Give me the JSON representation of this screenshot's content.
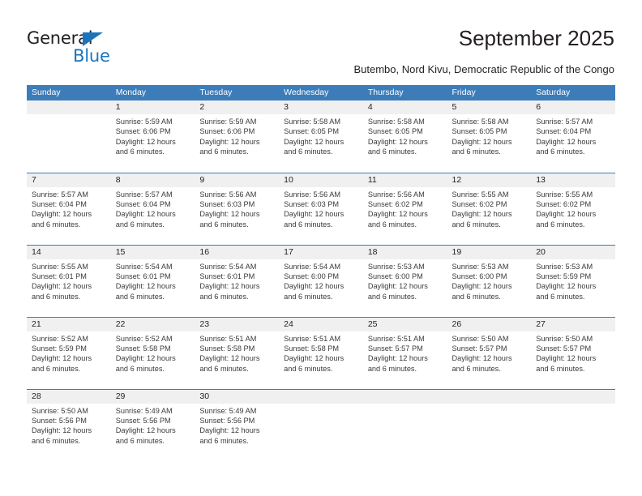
{
  "brand": {
    "line1": "General",
    "line2": "Blue",
    "triangle_icon": "triangle-icon",
    "color_dark": "#231f20",
    "color_blue": "#1c75bc"
  },
  "header": {
    "title": "September 2025",
    "subtitle": "Butembo, Nord Kivu, Democratic Republic of the Congo"
  },
  "calendar": {
    "header_color": "#3c7cb9",
    "daynum_bg": "#f0f0f0",
    "weekdays": [
      "Sunday",
      "Monday",
      "Tuesday",
      "Wednesday",
      "Thursday",
      "Friday",
      "Saturday"
    ],
    "weeks": [
      [
        {
          "day": "",
          "sunrise": "",
          "sunset": "",
          "daylight1": "",
          "daylight2": ""
        },
        {
          "day": "1",
          "sunrise": "Sunrise: 5:59 AM",
          "sunset": "Sunset: 6:06 PM",
          "daylight1": "Daylight: 12 hours",
          "daylight2": "and 6 minutes."
        },
        {
          "day": "2",
          "sunrise": "Sunrise: 5:59 AM",
          "sunset": "Sunset: 6:06 PM",
          "daylight1": "Daylight: 12 hours",
          "daylight2": "and 6 minutes."
        },
        {
          "day": "3",
          "sunrise": "Sunrise: 5:58 AM",
          "sunset": "Sunset: 6:05 PM",
          "daylight1": "Daylight: 12 hours",
          "daylight2": "and 6 minutes."
        },
        {
          "day": "4",
          "sunrise": "Sunrise: 5:58 AM",
          "sunset": "Sunset: 6:05 PM",
          "daylight1": "Daylight: 12 hours",
          "daylight2": "and 6 minutes."
        },
        {
          "day": "5",
          "sunrise": "Sunrise: 5:58 AM",
          "sunset": "Sunset: 6:05 PM",
          "daylight1": "Daylight: 12 hours",
          "daylight2": "and 6 minutes."
        },
        {
          "day": "6",
          "sunrise": "Sunrise: 5:57 AM",
          "sunset": "Sunset: 6:04 PM",
          "daylight1": "Daylight: 12 hours",
          "daylight2": "and 6 minutes."
        }
      ],
      [
        {
          "day": "7",
          "sunrise": "Sunrise: 5:57 AM",
          "sunset": "Sunset: 6:04 PM",
          "daylight1": "Daylight: 12 hours",
          "daylight2": "and 6 minutes."
        },
        {
          "day": "8",
          "sunrise": "Sunrise: 5:57 AM",
          "sunset": "Sunset: 6:04 PM",
          "daylight1": "Daylight: 12 hours",
          "daylight2": "and 6 minutes."
        },
        {
          "day": "9",
          "sunrise": "Sunrise: 5:56 AM",
          "sunset": "Sunset: 6:03 PM",
          "daylight1": "Daylight: 12 hours",
          "daylight2": "and 6 minutes."
        },
        {
          "day": "10",
          "sunrise": "Sunrise: 5:56 AM",
          "sunset": "Sunset: 6:03 PM",
          "daylight1": "Daylight: 12 hours",
          "daylight2": "and 6 minutes."
        },
        {
          "day": "11",
          "sunrise": "Sunrise: 5:56 AM",
          "sunset": "Sunset: 6:02 PM",
          "daylight1": "Daylight: 12 hours",
          "daylight2": "and 6 minutes."
        },
        {
          "day": "12",
          "sunrise": "Sunrise: 5:55 AM",
          "sunset": "Sunset: 6:02 PM",
          "daylight1": "Daylight: 12 hours",
          "daylight2": "and 6 minutes."
        },
        {
          "day": "13",
          "sunrise": "Sunrise: 5:55 AM",
          "sunset": "Sunset: 6:02 PM",
          "daylight1": "Daylight: 12 hours",
          "daylight2": "and 6 minutes."
        }
      ],
      [
        {
          "day": "14",
          "sunrise": "Sunrise: 5:55 AM",
          "sunset": "Sunset: 6:01 PM",
          "daylight1": "Daylight: 12 hours",
          "daylight2": "and 6 minutes."
        },
        {
          "day": "15",
          "sunrise": "Sunrise: 5:54 AM",
          "sunset": "Sunset: 6:01 PM",
          "daylight1": "Daylight: 12 hours",
          "daylight2": "and 6 minutes."
        },
        {
          "day": "16",
          "sunrise": "Sunrise: 5:54 AM",
          "sunset": "Sunset: 6:01 PM",
          "daylight1": "Daylight: 12 hours",
          "daylight2": "and 6 minutes."
        },
        {
          "day": "17",
          "sunrise": "Sunrise: 5:54 AM",
          "sunset": "Sunset: 6:00 PM",
          "daylight1": "Daylight: 12 hours",
          "daylight2": "and 6 minutes."
        },
        {
          "day": "18",
          "sunrise": "Sunrise: 5:53 AM",
          "sunset": "Sunset: 6:00 PM",
          "daylight1": "Daylight: 12 hours",
          "daylight2": "and 6 minutes."
        },
        {
          "day": "19",
          "sunrise": "Sunrise: 5:53 AM",
          "sunset": "Sunset: 6:00 PM",
          "daylight1": "Daylight: 12 hours",
          "daylight2": "and 6 minutes."
        },
        {
          "day": "20",
          "sunrise": "Sunrise: 5:53 AM",
          "sunset": "Sunset: 5:59 PM",
          "daylight1": "Daylight: 12 hours",
          "daylight2": "and 6 minutes."
        }
      ],
      [
        {
          "day": "21",
          "sunrise": "Sunrise: 5:52 AM",
          "sunset": "Sunset: 5:59 PM",
          "daylight1": "Daylight: 12 hours",
          "daylight2": "and 6 minutes."
        },
        {
          "day": "22",
          "sunrise": "Sunrise: 5:52 AM",
          "sunset": "Sunset: 5:58 PM",
          "daylight1": "Daylight: 12 hours",
          "daylight2": "and 6 minutes."
        },
        {
          "day": "23",
          "sunrise": "Sunrise: 5:51 AM",
          "sunset": "Sunset: 5:58 PM",
          "daylight1": "Daylight: 12 hours",
          "daylight2": "and 6 minutes."
        },
        {
          "day": "24",
          "sunrise": "Sunrise: 5:51 AM",
          "sunset": "Sunset: 5:58 PM",
          "daylight1": "Daylight: 12 hours",
          "daylight2": "and 6 minutes."
        },
        {
          "day": "25",
          "sunrise": "Sunrise: 5:51 AM",
          "sunset": "Sunset: 5:57 PM",
          "daylight1": "Daylight: 12 hours",
          "daylight2": "and 6 minutes."
        },
        {
          "day": "26",
          "sunrise": "Sunrise: 5:50 AM",
          "sunset": "Sunset: 5:57 PM",
          "daylight1": "Daylight: 12 hours",
          "daylight2": "and 6 minutes."
        },
        {
          "day": "27",
          "sunrise": "Sunrise: 5:50 AM",
          "sunset": "Sunset: 5:57 PM",
          "daylight1": "Daylight: 12 hours",
          "daylight2": "and 6 minutes."
        }
      ],
      [
        {
          "day": "28",
          "sunrise": "Sunrise: 5:50 AM",
          "sunset": "Sunset: 5:56 PM",
          "daylight1": "Daylight: 12 hours",
          "daylight2": "and 6 minutes."
        },
        {
          "day": "29",
          "sunrise": "Sunrise: 5:49 AM",
          "sunset": "Sunset: 5:56 PM",
          "daylight1": "Daylight: 12 hours",
          "daylight2": "and 6 minutes."
        },
        {
          "day": "30",
          "sunrise": "Sunrise: 5:49 AM",
          "sunset": "Sunset: 5:56 PM",
          "daylight1": "Daylight: 12 hours",
          "daylight2": "and 6 minutes."
        },
        {
          "day": "",
          "sunrise": "",
          "sunset": "",
          "daylight1": "",
          "daylight2": ""
        },
        {
          "day": "",
          "sunrise": "",
          "sunset": "",
          "daylight1": "",
          "daylight2": ""
        },
        {
          "day": "",
          "sunrise": "",
          "sunset": "",
          "daylight1": "",
          "daylight2": ""
        },
        {
          "day": "",
          "sunrise": "",
          "sunset": "",
          "daylight1": "",
          "daylight2": ""
        }
      ]
    ]
  }
}
